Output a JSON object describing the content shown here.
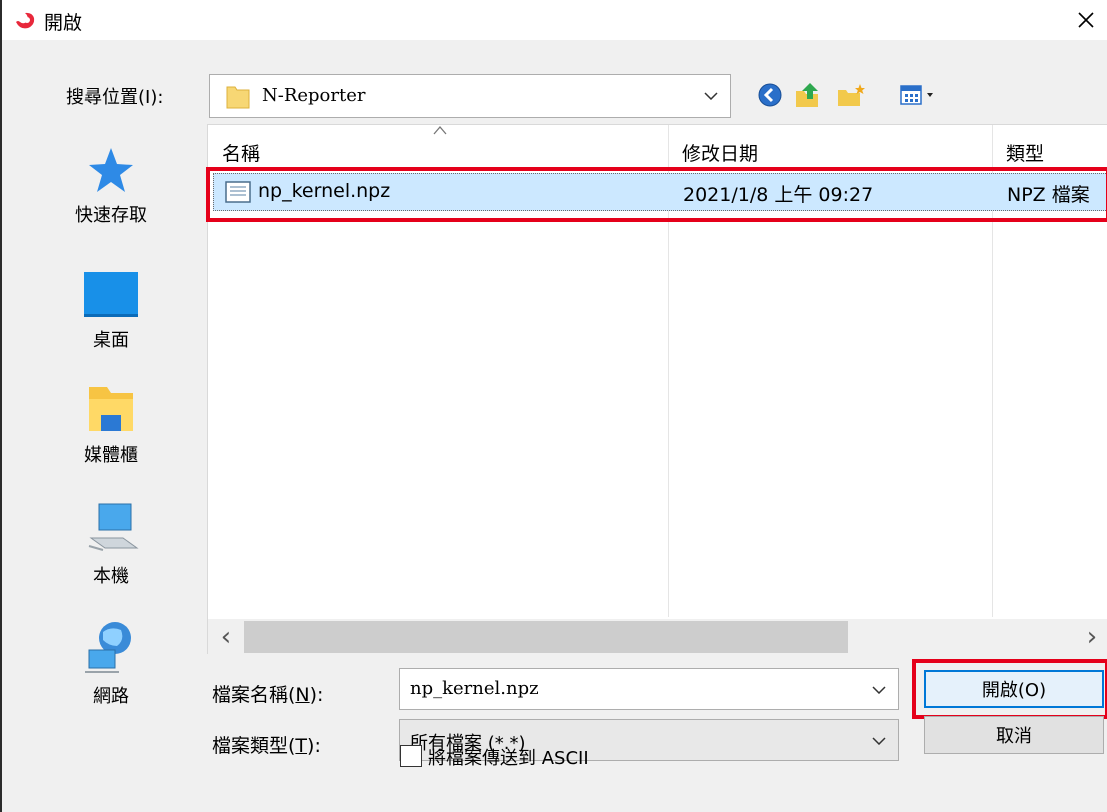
{
  "window": {
    "title": "開啟",
    "close_glyph": "✕"
  },
  "look_in": {
    "label": "搜尋位置(I):",
    "value": "N-Reporter"
  },
  "places": [
    {
      "label": "快速存取",
      "icon": "star-icon"
    },
    {
      "label": "桌面",
      "icon": "desktop-icon"
    },
    {
      "label": "媒體櫃",
      "icon": "library-icon"
    },
    {
      "label": "本機",
      "icon": "computer-icon"
    },
    {
      "label": "網路",
      "icon": "network-icon"
    }
  ],
  "file_list": {
    "columns": [
      "名稱",
      "修改日期",
      "類型"
    ],
    "rows": [
      {
        "name": "np_kernel.npz",
        "modified": "2021/1/8 上午 09:27",
        "type": "NPZ 檔案"
      }
    ]
  },
  "scroll": {
    "left_glyph": "‹",
    "right_glyph": "›"
  },
  "file_name": {
    "label_prefix": "檔案名稱(",
    "label_key": "N",
    "label_suffix": "):",
    "value": "np_kernel.npz"
  },
  "file_type": {
    "label_prefix": "檔案類型(",
    "label_key": "T",
    "label_suffix": "):",
    "value": "所有檔案 (*.*)"
  },
  "buttons": {
    "open": "開啟(O)",
    "cancel": "取消"
  },
  "ascii_option": {
    "label": "將檔案傳送到 ASCII",
    "checked": false
  },
  "colors": {
    "selection": "#cce8ff",
    "highlight": "#e5001a",
    "focus": "#0078d7"
  }
}
